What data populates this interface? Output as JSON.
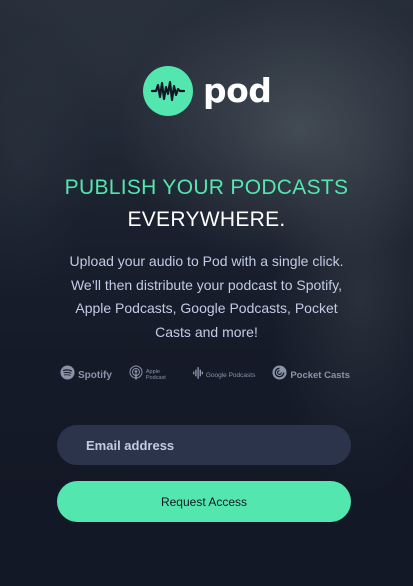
{
  "brand": {
    "name": "pod",
    "logo_icon": "waveform-icon",
    "accent_color": "#54e6af"
  },
  "headline": {
    "line1": "PUBLISH YOUR PODCASTS",
    "line2": "EVERYWHERE."
  },
  "description": "Upload your audio to Pod with a single click. We’ll then distribute your podcast to Spotify, Apple Podcasts, Google Podcasts, Pocket Casts and more!",
  "platforms": [
    {
      "label": "Spotify",
      "icon": "spotify-icon"
    },
    {
      "label": "Apple Podcast",
      "icon": "apple-podcasts-icon"
    },
    {
      "label": "Google Podcasts",
      "icon": "google-podcasts-icon"
    },
    {
      "label": "Pocket Casts",
      "icon": "pocket-casts-icon"
    }
  ],
  "form": {
    "email_placeholder": "Email address",
    "email_value": "",
    "submit_label": "Request Access"
  },
  "colors": {
    "background": "#121725",
    "input_background": "#2c344b",
    "text_muted": "#c2cbe5"
  }
}
